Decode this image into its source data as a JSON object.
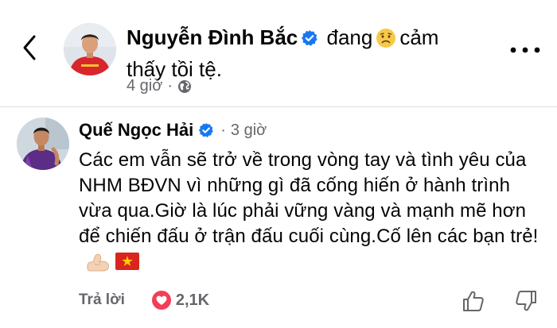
{
  "post": {
    "author": "Nguyễn Đình Bắc",
    "status_prefix": "đang",
    "status_suffix_line1": "cảm",
    "status_line2": "thấy tồi tệ.",
    "time": "4 giờ",
    "separator": "·"
  },
  "comment": {
    "author": "Quế Ngọc Hải",
    "separator": "·",
    "time": "3 giờ",
    "text": "Các em vẫn sẽ trở về trong vòng tay và tình yêu của NHM BĐVN vì những gì đã cống hiến ở hành trình vừa qua.Giờ là lúc phải vững vàng và mạnh mẽ hơn để chiến đấu ở trận đấu cuối cùng.Cố lên các bạn trẻ!",
    "reply_label": "Trả lời",
    "reaction_count": "2,1K"
  },
  "icons": {
    "back": "chevron-left-icon",
    "more": "more-dots-icon",
    "verified": "verified-badge-icon",
    "feeling": "sad-face-emoji",
    "audience": "globe-icon",
    "heart": "heart-reaction-icon",
    "like": "thumbs-up-icon",
    "dislike": "thumbs-down-icon",
    "muscle": "flexed-biceps-emoji",
    "flag": "vietnam-flag-emoji"
  },
  "colors": {
    "verified_blue": "#1877f2",
    "heart_red": "#f33e58",
    "secondary_text": "#65676b",
    "divider": "#dadde1"
  }
}
